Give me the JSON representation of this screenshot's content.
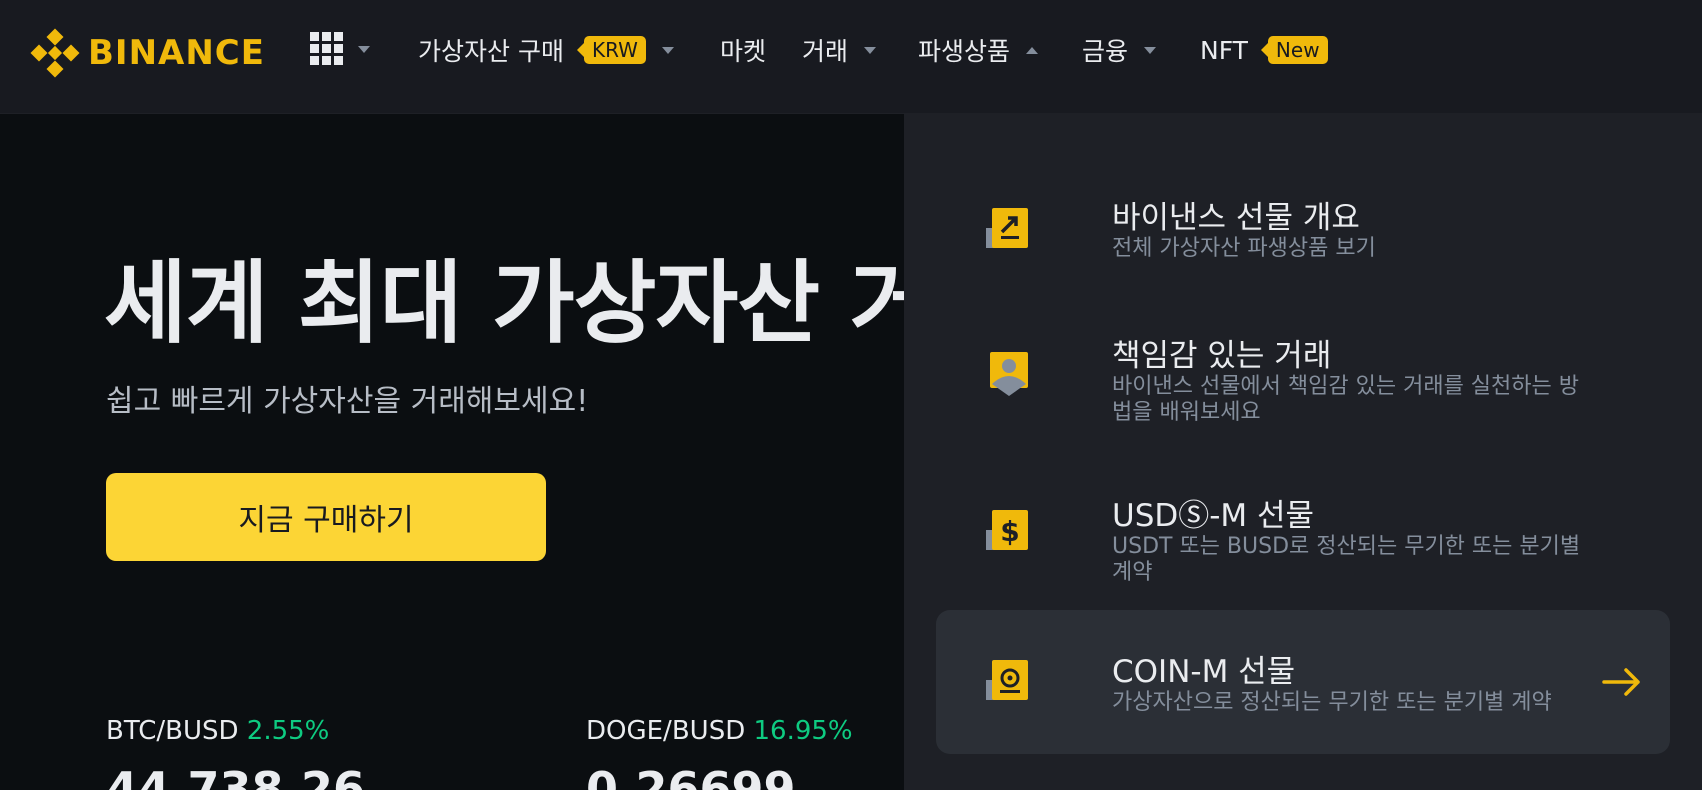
{
  "brand": {
    "name": "BINANCE",
    "color": "#f0b90b"
  },
  "header": {
    "apps_icon": "grid-icon",
    "nav": [
      {
        "label": "가상자산 구매",
        "badge": "KRW",
        "dropdown": true
      },
      {
        "label": "마켓",
        "dropdown": false
      },
      {
        "label": "거래",
        "dropdown": true
      },
      {
        "label": "파생상품",
        "dropdown": true,
        "open": true
      },
      {
        "label": "금융",
        "dropdown": true
      },
      {
        "label": "NFT",
        "badge": "New",
        "dropdown": false
      }
    ]
  },
  "hero": {
    "title": "세계 최대 가상자산 거",
    "subtitle": "쉽고 빠르게 가상자산을 거래해보세요!",
    "cta": "지금 구매하기"
  },
  "tickers": [
    {
      "pair": "BTC/BUSD",
      "change": "2.55%",
      "price": "44,738.26"
    },
    {
      "pair": "DOGE/BUSD",
      "change": "16.95%",
      "price": "0.26699"
    }
  ],
  "derivatives_menu": {
    "items": [
      {
        "title": "바이낸스 선물 개요",
        "desc": "전체 가상자산 파생상품 보기",
        "icon": "futures-overview-icon"
      },
      {
        "title": "책임감 있는 거래",
        "desc": "바이낸스 선물에서 책임감 있는 거래를 실천하는 방법을 배워보세요",
        "icon": "responsible-trading-icon"
      },
      {
        "title": "USDⓈ-M 선물",
        "desc": "USDT 또는 BUSD로 정산되는 무기한 또는 분기별 계약",
        "icon": "usd-futures-icon"
      },
      {
        "title": "COIN-M 선물",
        "desc": "가상자산으로 정산되는 무기한 또는 분기별 계약",
        "icon": "coin-futures-icon",
        "active": true
      }
    ]
  },
  "colors": {
    "accent": "#fcd535",
    "positive": "#0ecb81",
    "panel": "#1e2026",
    "header": "#181a20"
  }
}
